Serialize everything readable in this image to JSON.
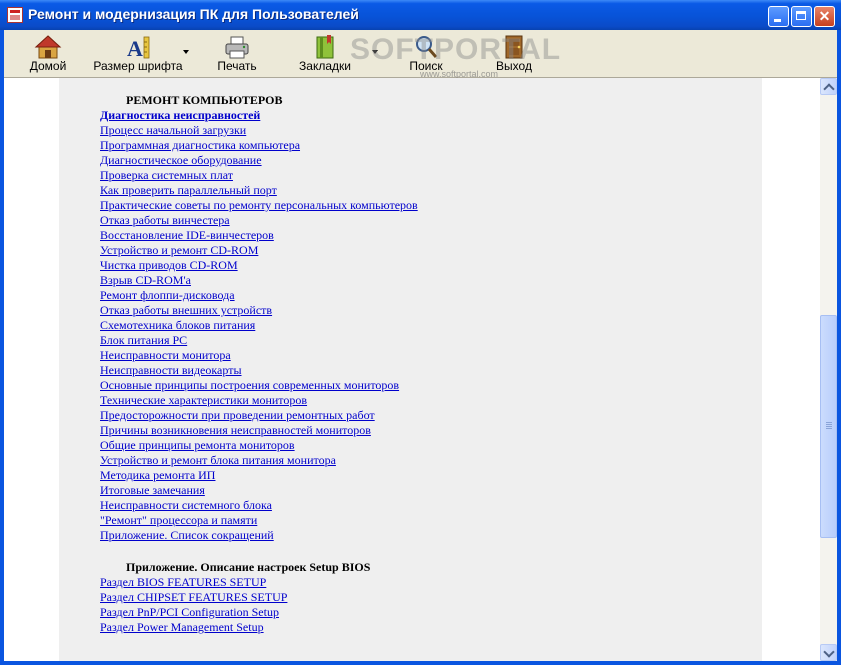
{
  "window": {
    "title": "Ремонт и модернизация ПК для Пользователей",
    "controls": [
      "minimize",
      "maximize",
      "close"
    ]
  },
  "toolbar": {
    "home_label": "Домой",
    "font_size_label": "Размер шрифта",
    "print_label": "Печать",
    "bookmarks_label": "Закладки",
    "search_label": "Поиск",
    "exit_label": "Выход"
  },
  "watermark": {
    "text": "SOFTPORTAL",
    "url": "www.softportal.com"
  },
  "content": {
    "section1_heading": "РЕМОНТ КОМПЬЮТЕРОВ",
    "section1_links": [
      "Диагностика неисправностей",
      "Процесс начальной загрузки",
      "Программная диагностика компьютера",
      "Диагностическое оборудование",
      "Проверка системных плат",
      "Как проверить параллельный порт",
      "Практические советы по ремонту персональных компьютеров",
      "Отказ работы винчестера",
      "Восстановление IDE-винчестеров",
      "Устройство и ремонт CD-ROM",
      "Чистка приводов CD-ROM",
      "Взрыв CD-ROM'a",
      "Ремонт флоппи-дисковода",
      "Отказ работы внешних устройств",
      "Схемотехника блоков питания",
      "Блок питания PC",
      "Неисправности монитора",
      "Неисправности видеокарты",
      "Основные принципы построения современных мониторов",
      "Технические характеристики мониторов",
      "Предосторожности при проведении ремонтных работ",
      "Причины возникновения неисправностей мониторов",
      "Общие принципы ремонта мониторов",
      "Устройство и ремонт блока питания монитора",
      "Методика ремонта ИП",
      "Итоговые замечания",
      "Неисправности системного блока",
      "\"Ремонт\" процессора и памяти",
      "Приложение. Список сокращений"
    ],
    "section2_heading": "Приложение. Описание настроек Setup BIOS",
    "section2_links": [
      "Раздел BIOS FEATURES SETUP",
      "Раздел CHIPSET FEATURES SETUP",
      "Раздел PnP/PCI Configuration Setup",
      "Раздел Power Management Setup"
    ]
  },
  "colors": {
    "titlebar": "#0853d8",
    "toolbar_bg": "#ece9d8",
    "page_bg": "#efefef",
    "link": "#0000cc"
  }
}
